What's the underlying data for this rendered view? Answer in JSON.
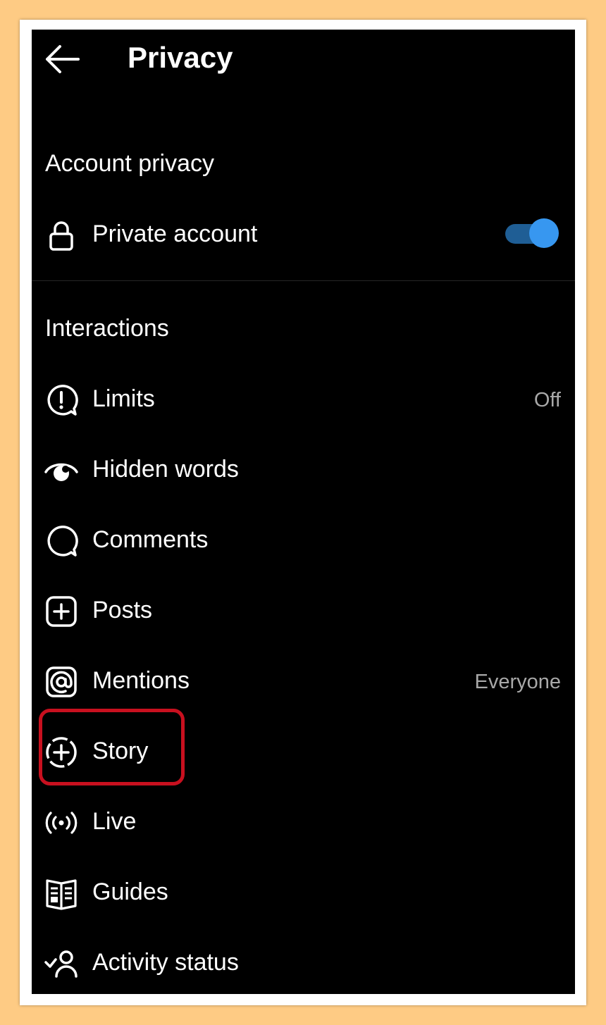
{
  "header": {
    "title": "Privacy",
    "back_icon": "arrow-left-icon"
  },
  "account_privacy": {
    "section_title": "Account privacy",
    "private_account": {
      "label": "Private account",
      "icon": "lock-icon",
      "toggle_on": true,
      "toggle_color": "#3797f0"
    }
  },
  "interactions": {
    "section_title": "Interactions",
    "items": [
      {
        "label": "Limits",
        "value": "Off",
        "icon": "limits-alert-icon"
      },
      {
        "label": "Hidden words",
        "value": "",
        "icon": "hidden-words-eye-icon"
      },
      {
        "label": "Comments",
        "value": "",
        "icon": "comment-bubble-icon"
      },
      {
        "label": "Posts",
        "value": "",
        "icon": "plus-square-icon"
      },
      {
        "label": "Mentions",
        "value": "Everyone",
        "icon": "at-sign-icon"
      },
      {
        "label": "Story",
        "value": "",
        "icon": "story-add-icon"
      },
      {
        "label": "Live",
        "value": "",
        "icon": "live-broadcast-icon"
      },
      {
        "label": "Guides",
        "value": "",
        "icon": "guides-book-icon"
      },
      {
        "label": "Activity status",
        "value": "",
        "icon": "activity-status-icon"
      }
    ]
  },
  "annotation": {
    "highlighted_item": "Story",
    "highlight_color": "#c8101f"
  },
  "colors": {
    "background": "#fecb84",
    "screen": "#000000",
    "text": "#ffffff",
    "secondary_text": "#a8a8a8"
  }
}
